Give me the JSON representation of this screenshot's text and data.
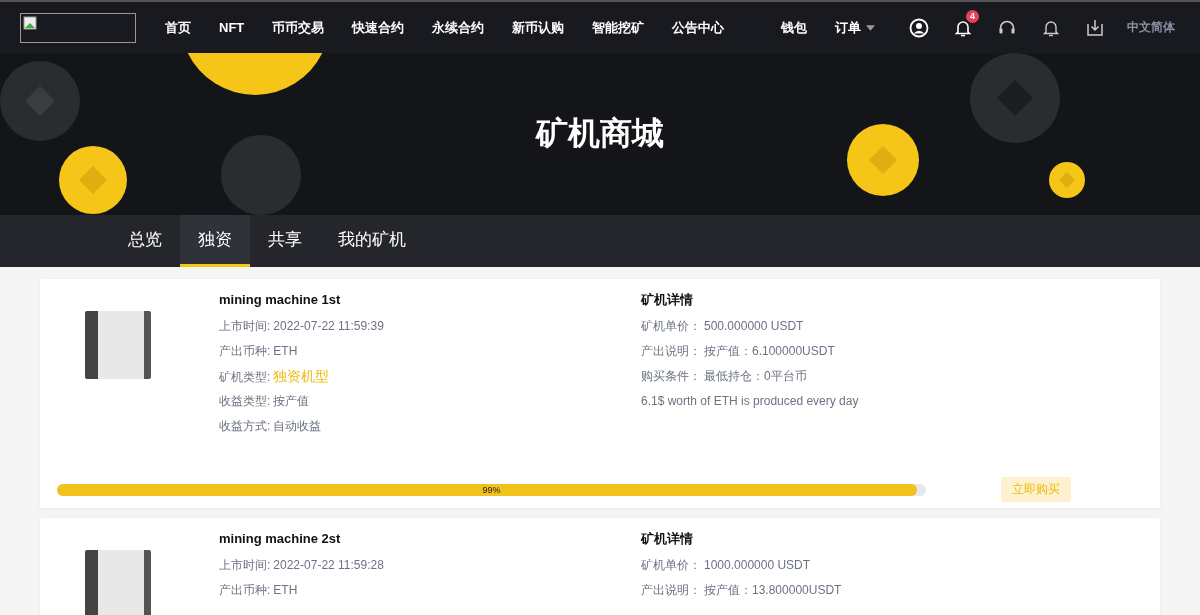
{
  "nav": {
    "links": [
      {
        "label": "首页"
      },
      {
        "label": "NFT"
      },
      {
        "label": "币币交易"
      },
      {
        "label": "快速合约"
      },
      {
        "label": "永续合约"
      },
      {
        "label": "新币认购"
      },
      {
        "label": "智能挖矿"
      },
      {
        "label": "公告中心"
      }
    ],
    "right_links": [
      {
        "label": "钱包",
        "dropdown": false
      },
      {
        "label": "订单",
        "dropdown": true
      }
    ],
    "notification_badge": "4",
    "language": "中文简体"
  },
  "banner": {
    "title": "矿机商城"
  },
  "tabs": [
    {
      "label": "总览",
      "selected": false
    },
    {
      "label": "独资",
      "selected": true
    },
    {
      "label": "共享",
      "selected": false
    },
    {
      "label": "我的矿机",
      "selected": false
    }
  ],
  "cards": [
    {
      "title": "mining machine 1st",
      "info": [
        {
          "label": "上市时间:",
          "value": "2022-07-22 11:59:39",
          "kind": "plain"
        },
        {
          "label": "产出币种:",
          "value": "ETH",
          "kind": "plain"
        },
        {
          "label": "矿机类型:",
          "value": "独资机型",
          "kind": "highlight"
        },
        {
          "label": "收益类型:",
          "value": "按产值",
          "kind": "plain"
        },
        {
          "label": "收益方式:",
          "value": "自动收益",
          "kind": "plain"
        }
      ],
      "details_title": "矿机详情",
      "details": [
        {
          "label": "矿机单价：",
          "value": "500.000000 USDT"
        },
        {
          "label": "产出说明：",
          "value": "按产值：6.100000USDT"
        },
        {
          "label": "购买条件：",
          "value": "最低持仓：0平台币"
        }
      ],
      "note": "6.1$ worth of ETH is produced every day",
      "progress": {
        "level": 0.99,
        "label": "99%"
      },
      "button": "立即购买"
    },
    {
      "title": "mining machine 2st",
      "info": [
        {
          "label": "上市时间:",
          "value": "2022-07-22 11:59:28",
          "kind": "plain"
        },
        {
          "label": "产出币种:",
          "value": "ETH",
          "kind": "plain"
        }
      ],
      "details_title": "矿机详情",
      "details": [
        {
          "label": "矿机单价：",
          "value": "1000.000000 USDT"
        },
        {
          "label": "产出说明：",
          "value": "按产值：13.800000USDT"
        }
      ]
    }
  ]
}
